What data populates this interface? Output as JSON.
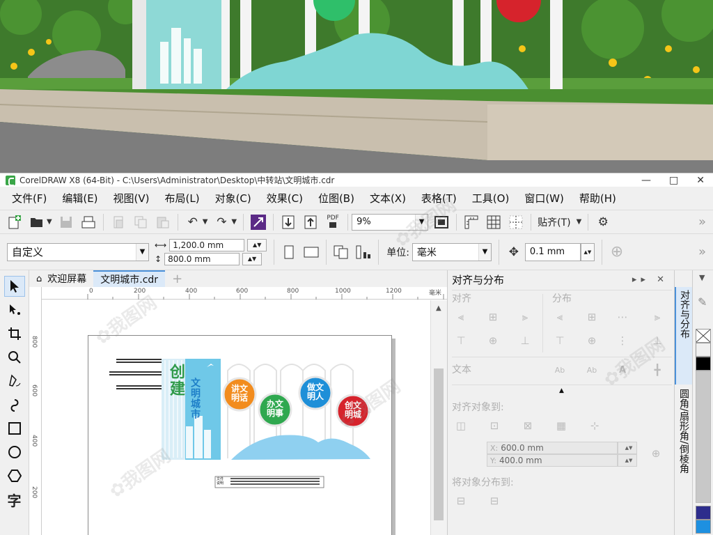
{
  "window": {
    "title": "CorelDRAW X8 (64-Bit) - C:\\Users\\Administrator\\Desktop\\中转站\\文明城市.cdr",
    "controls": [
      "—",
      "□",
      "✕"
    ]
  },
  "menu": [
    "文件(F)",
    "编辑(E)",
    "视图(V)",
    "布局(L)",
    "对象(C)",
    "效果(C)",
    "位图(B)",
    "文本(X)",
    "表格(T)",
    "工具(O)",
    "窗口(W)",
    "帮助(H)"
  ],
  "toolbar1": {
    "pdf_label": "PDF",
    "zoom": "9%",
    "snap_label": "贴齐(T)"
  },
  "toolbar2": {
    "page_preset": "自定义",
    "width": "1,200.0 mm",
    "height": "800.0 mm",
    "units_label": "单位:",
    "units_value": "毫米",
    "nudge": "0.1 mm"
  },
  "doc_tabs": {
    "welcome": "欢迎屏幕",
    "file": "文明城市.cdr"
  },
  "ruler": {
    "unit": "毫米",
    "h_ticks": [
      "0",
      "200",
      "400",
      "600",
      "800",
      "1000",
      "1200"
    ],
    "v_ticks": [
      "800",
      "600",
      "400",
      "200"
    ]
  },
  "artwork": {
    "vertical_title": "创建",
    "subtitle": "文明城市",
    "circles": [
      {
        "text": "讲文明话",
        "color": "#f28c1e"
      },
      {
        "text": "办文明事",
        "color": "#2fa84f"
      },
      {
        "text": "做文明人",
        "color": "#1e8fd8"
      },
      {
        "text": "创文明城",
        "color": "#d6232c"
      }
    ],
    "note_label": "文件\n说明"
  },
  "docker": {
    "title": "对齐与分布",
    "align_label": "对齐",
    "distribute_label": "分布",
    "text_label": "文本",
    "align_to_label": "对齐对象到:",
    "x_label": "X:",
    "x_value": "600.0 mm",
    "y_label": "Y:",
    "y_value": "400.0 mm",
    "distribute_to_label": "将对象分布到:"
  },
  "docker_tabs": [
    "对齐与分布",
    "圆角/扇形角/倒棱角"
  ],
  "palette": [
    "#ffffff",
    "#000000",
    "#c8c8c8",
    "#2d2d8c",
    "#1e90e0"
  ]
}
